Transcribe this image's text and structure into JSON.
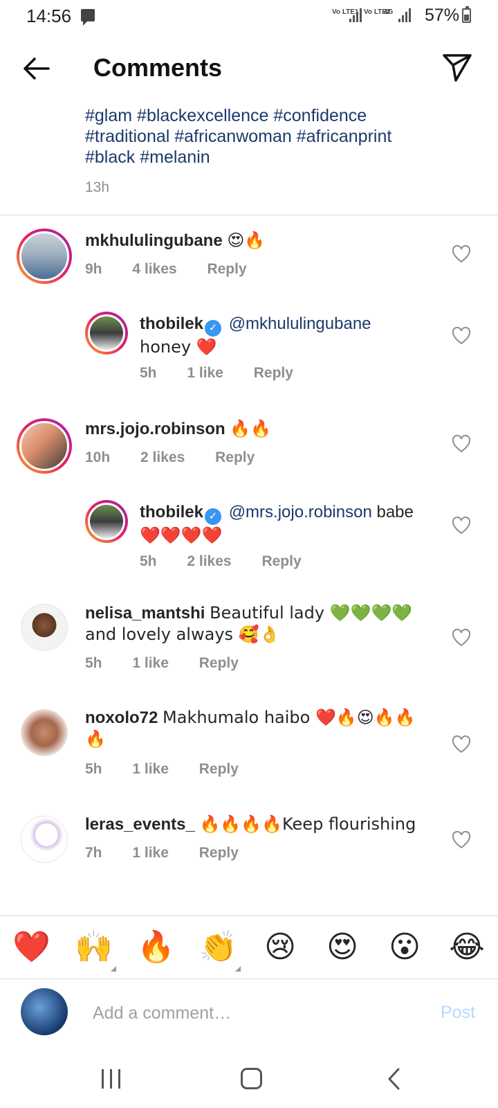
{
  "status_bar": {
    "time": "14:56",
    "net1": "Vo LTE1",
    "net2": "Vo LTE2",
    "net3": "4G",
    "battery": "57%"
  },
  "header": {
    "title": "Comments",
    "back_icon": "arrow-left-icon",
    "send_icon": "paper-plane-icon"
  },
  "caption": {
    "line1": "#glam #blackexcellence #confidence",
    "line2": "#traditional #africanwoman  #africanprint",
    "line3": "#black #melanin",
    "time": "13h"
  },
  "comments": [
    {
      "username": "mkhululingubane",
      "text": "😍🔥",
      "time": "9h",
      "likes": "4 likes",
      "reply": "Reply"
    },
    {
      "username": "thobilek",
      "mention": "@mkhululingubane",
      "text": "honey ❤️",
      "time": "5h",
      "likes": "1 like",
      "reply": "Reply"
    },
    {
      "username": "mrs.jojo.robinson",
      "text": "🔥🔥",
      "time": "10h",
      "likes": "2 likes",
      "reply": "Reply"
    },
    {
      "username": "thobilek",
      "mention": "@mrs.jojo.robinson",
      "text": "babe",
      "text2": "❤️❤️❤️❤️",
      "time": "5h",
      "likes": "2 likes",
      "reply": "Reply"
    },
    {
      "username": "nelisa_mantshi",
      "text": "Beautiful lady 💚💚💚💚",
      "text2": "and lovely always 🥰👌",
      "time": "5h",
      "likes": "1 like",
      "reply": "Reply"
    },
    {
      "username": "noxolo72",
      "text": "Makhumalo haibo ❤️🔥😍🔥🔥",
      "text2": "🔥",
      "time": "5h",
      "likes": "1 like",
      "reply": "Reply"
    },
    {
      "username": "leras_events_",
      "text": "🔥🔥🔥🔥Keep flourishing",
      "time": "7h",
      "likes": "1 like",
      "reply": "Reply"
    }
  ],
  "reactions": [
    "❤️",
    "🙌",
    "🔥",
    "👏",
    "😢",
    "😍",
    "😮",
    "😂"
  ],
  "compose": {
    "placeholder": "Add a comment…",
    "post_label": "Post"
  },
  "colors": {
    "link": "#1b3a6b",
    "secondary_text": "#8e8e8e",
    "verified": "#3897f0",
    "post_disabled": "#b3dbff"
  }
}
